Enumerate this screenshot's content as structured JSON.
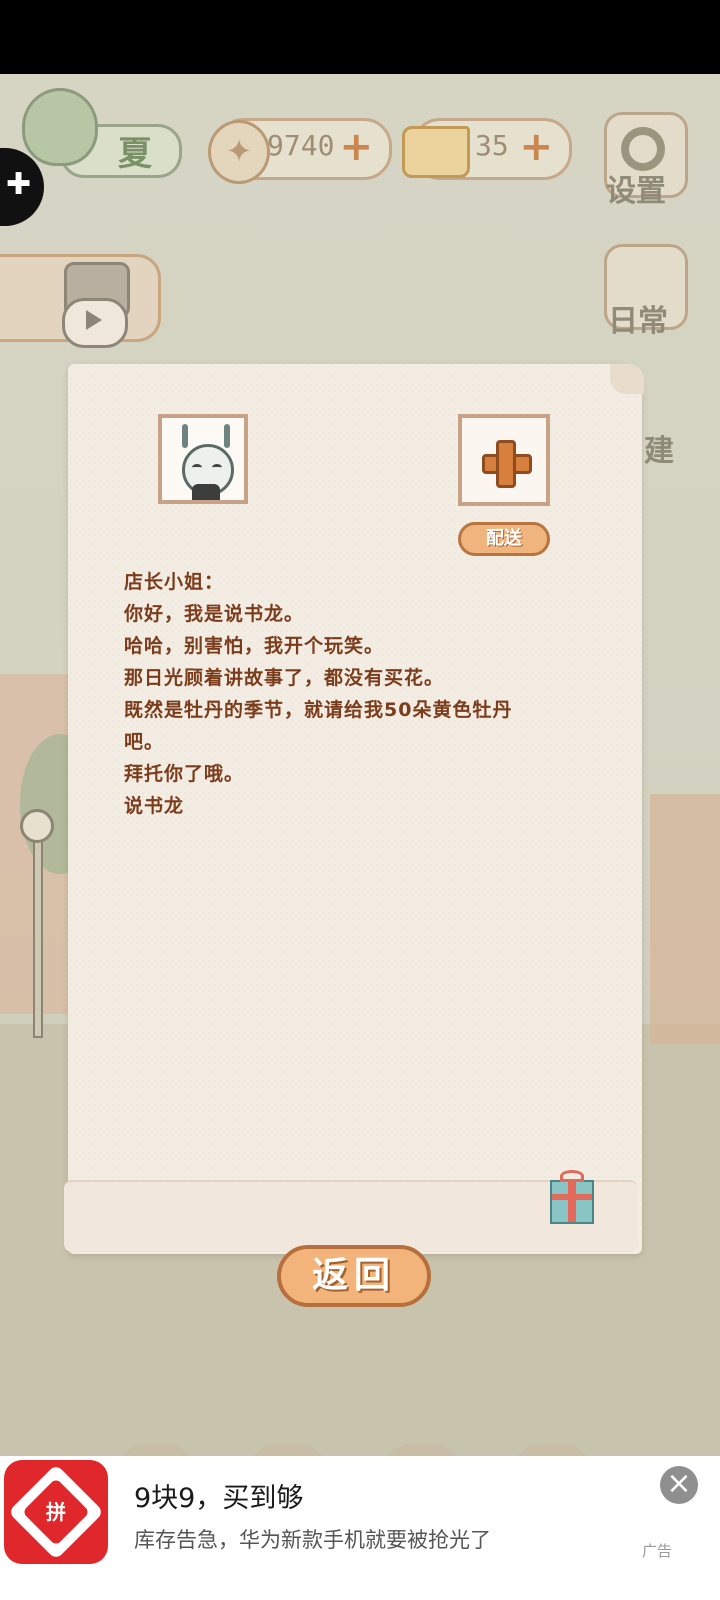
{
  "hud": {
    "season_label": "夏",
    "fish_coins": "9740",
    "cheese": "35",
    "plus_symbol": "+",
    "settings_label": "设置",
    "daily_label": "日常",
    "build_label_partial": "建"
  },
  "side_tab_icon": "puzzle-icon",
  "letter": {
    "deliver_label": "配送",
    "lines": [
      "店长小姐：",
      "你好，我是说书龙。",
      "哈哈，别害怕，我开个玩笑。",
      "那日光顾着讲故事了，都没有买花。",
      "既然是牡丹的季节，就请给我50朵黄色牡丹",
      "吧。",
      "拜托你了哦。",
      "说书龙"
    ],
    "back_label": "返回"
  },
  "ad": {
    "title": "9块9，买到够",
    "subtitle": "库存告急，华为新款手机就要被抢光了",
    "logo_char": "拼",
    "close_symbol": "×",
    "ad_mark": "广告",
    "brand_color": "#e0272b"
  }
}
